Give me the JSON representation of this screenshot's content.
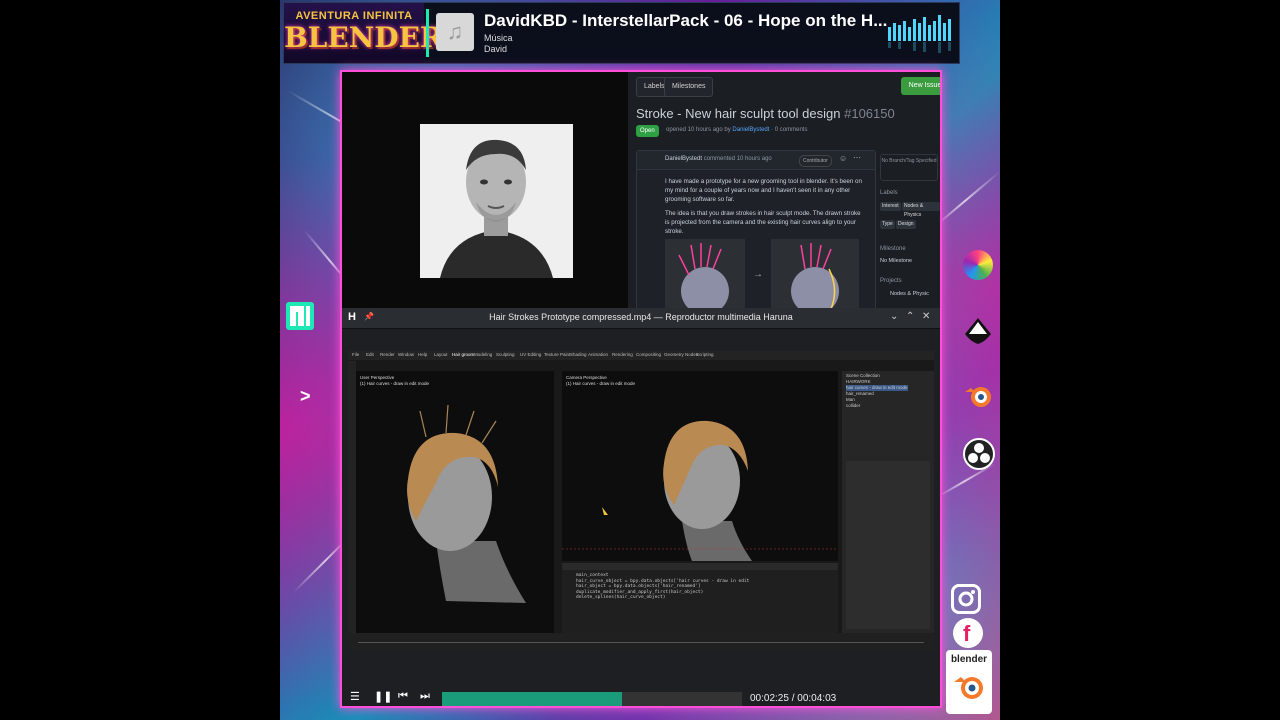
{
  "now_playing": {
    "logo_top": "AVENTURA INFINITA",
    "logo_main": "BLENDER",
    "title": "DavidKBD - InterstellarPack - 06 - Hope on the H...",
    "subtitle": "Música",
    "artist": "David",
    "album_icon": "music-note-icon"
  },
  "github": {
    "tabs": [
      "Labels",
      "Milestones"
    ],
    "new_issue": "New Issue",
    "title": "Stroke - New hair sculpt tool design",
    "issue_number": "#106150",
    "status": "Open",
    "meta_prefix": "opened 10 hours ago by",
    "meta_author": "DanielBystedt",
    "meta_suffix": "· 0 comments",
    "comment_author": "DanielBystedt",
    "comment_action": "commented 10 hours ago",
    "comment_badge": "Contributor",
    "body_1": "I have made a prototype for a new grooming tool in blender. It's been on my mind for a couple of years now and I haven't seen it in any other grooming software so far.",
    "body_2": "The idea is that you draw strokes in hair sculpt mode. The drawn stroke is projected from the camera and the existing hair curves align to your stroke.",
    "sidebar": {
      "branch": "No Branch/Tag Specified",
      "labels_heading": "Labels",
      "labels": [
        "Interest",
        "Nodes & Physics"
      ],
      "type_labels": [
        "Type",
        "Design"
      ],
      "milestone_heading": "Milestone",
      "milestone": "No Milestone",
      "projects_heading": "Projects",
      "project": "Nodes & Physic"
    }
  },
  "haruna": {
    "logo": "H",
    "title": "Hair Strokes Prototype compressed.mp4 — Reproductor multimedia Haruna",
    "time": "00:02:25 / 00:04:03",
    "progress": 0.6
  },
  "blender": {
    "menu": [
      "File",
      "Edit",
      "Render",
      "Window",
      "Help",
      "Layout",
      "Hair groom",
      "Modeling",
      "Sculpting",
      "UV Editing",
      "Texture Paint",
      "Shading",
      "Animation",
      "Rendering",
      "Compositing",
      "Geometry Nodes",
      "Scripting"
    ],
    "vp1_info": [
      "User Perspective",
      "(1) Hair curves - draw in edit mode"
    ],
    "vp2_info": [
      "Camera Perspective",
      "(1) Hair curves - draw in edit mode"
    ],
    "code": [
      "main_context",
      "hair_curve_object = bpy.data.objects['hair curves - draw in edit",
      "hair_object = bpy.data.objects['hair_renamed']",
      "",
      "duplicate_modifier_and_apply_first(hair_object)",
      "delete_splines(hair_curve_object)"
    ],
    "outliner": [
      "Scene Collection",
      "HAIRWORK",
      "hair curves - draw in edit mode",
      "hair_renamed",
      "Man",
      "collider"
    ]
  },
  "social_icons": [
    "manjaro-icon",
    "chevron-right-icon",
    "krita-icon",
    "inkscape-icon",
    "blender-icon",
    "obs-icon",
    "instagram-icon",
    "facebook-icon"
  ],
  "blender_badge": "blender"
}
